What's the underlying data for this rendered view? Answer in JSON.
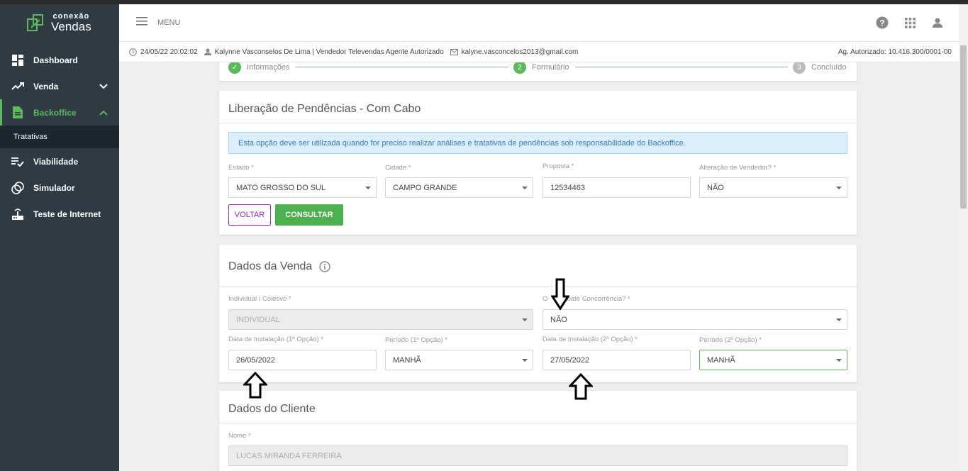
{
  "sidebar": {
    "logo_small": "conexão",
    "logo_big": "Vendas",
    "items": [
      {
        "label": "Dashboard"
      },
      {
        "label": "Venda"
      },
      {
        "label": "Backoffice"
      },
      {
        "label": "Viabilidade"
      },
      {
        "label": "Simulador"
      },
      {
        "label": "Teste de Internet"
      }
    ],
    "sub_item": "Tratativas"
  },
  "header": {
    "menu_label": "MENU"
  },
  "infobar": {
    "datetime": "24/05/22 20:02:02",
    "user": "Kalynne Vasconselos De Lima | Vendedor Televendas Agente Autorizado",
    "email": "kalyne.vasconcelos2013@gmail.com",
    "agent": "Ag. Autorizado: 10.416.300/0001-00"
  },
  "stepper": {
    "steps": [
      {
        "label": "Informações",
        "number": "✓"
      },
      {
        "label": "Formulário",
        "number": "2"
      },
      {
        "label": "Concluído",
        "number": "3"
      }
    ]
  },
  "liberacao": {
    "title": "Liberação de Pendências - Com Cabo",
    "alert": "Esta opção deve ser utilizada quando for preciso realizar análises e tratativas de pendências sob responsabilidade do Backoffice.",
    "estado_label": "Estado *",
    "estado_value": "MATO GROSSO DO SUL",
    "cidade_label": "Cidade *",
    "cidade_value": "CAMPO GRANDE",
    "proposta_label": "Proposta *",
    "proposta_value": "12534463",
    "alteracao_label": "Alteração de Vendedor? *",
    "alteracao_value": "NÃO",
    "voltar": "VOLTAR",
    "consultar": "CONSULTAR"
  },
  "venda": {
    "title": "Dados da Venda",
    "individual_label": "Individual / Coletivo *",
    "individual_value": "INDIVIDUAL",
    "combate_label_a": "O",
    "combate_label_b": "ombate Concorrência? *",
    "combate_value": "NÃO",
    "data1_label": "Data de Instalação (1º Opção) *",
    "data1_value": "26/05/2022",
    "periodo1_label": "Período (1º Opção) *",
    "periodo1_value": "MANHÃ",
    "data2_label": "Data de Instalação (2º Opção) *",
    "data2_value": "27/05/2022",
    "periodo2_label": "Período (2º Opção) *",
    "periodo2_value": "MANHÃ"
  },
  "cliente": {
    "title": "Dados do Cliente",
    "nome_label": "Nome *",
    "nome_value": "LUCAS MIRANDA FERREIRA"
  },
  "colors": {
    "sidebar": "#2f3a43",
    "accent": "#5cb85c",
    "voltar": "#9c27b0",
    "alert_bg": "#dbeefb"
  }
}
